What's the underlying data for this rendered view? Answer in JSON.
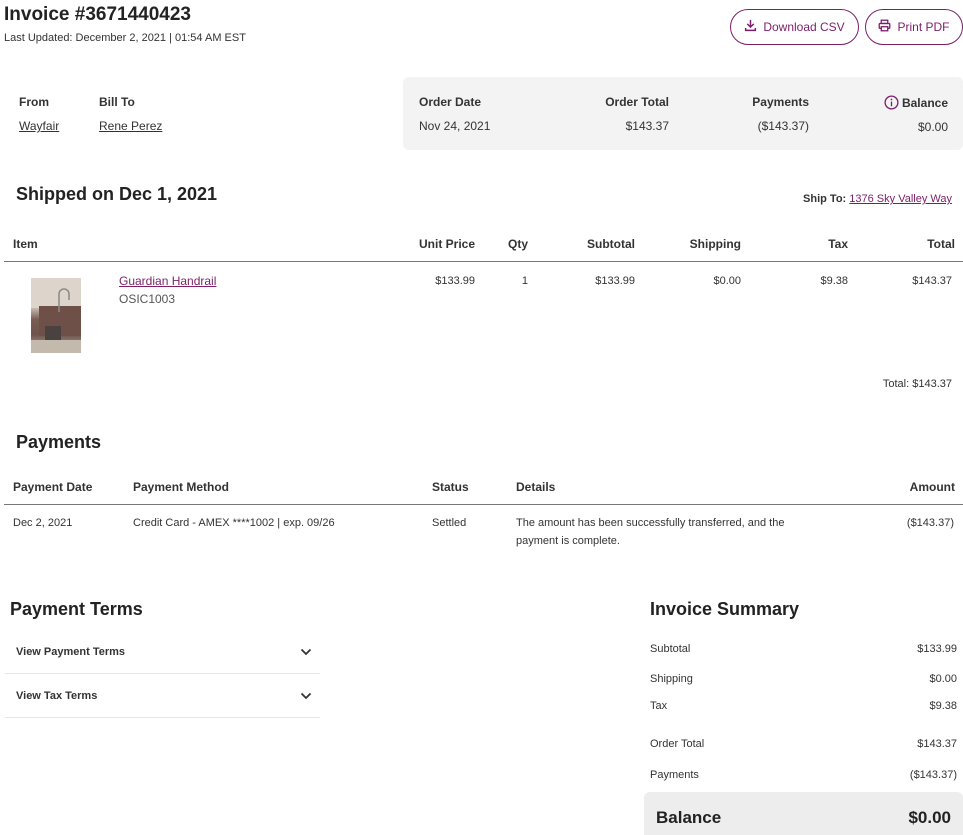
{
  "header": {
    "title": "Invoice #3671440423",
    "last_updated": "Last Updated: December 2, 2021 | 01:54 AM EST",
    "download_csv": "Download CSV",
    "print_pdf": "Print PDF",
    "download_icon": "download-icon",
    "print_icon": "printer-icon"
  },
  "parties": {
    "from_label": "From",
    "from_value": "Wayfair",
    "bill_to_label": "Bill To",
    "bill_to_value": "Rene Perez"
  },
  "order_summary": {
    "order_date_label": "Order Date",
    "order_date": "Nov 24, 2021",
    "order_total_label": "Order Total",
    "order_total": "$143.37",
    "payments_label": "Payments",
    "payments": "($143.37)",
    "balance_label": "Balance",
    "balance": "$0.00",
    "info_icon": "info-icon"
  },
  "shipment": {
    "title": "Shipped on Dec 1, 2021",
    "ship_to_label": "Ship To:",
    "ship_to_value": "1376 Sky Valley Way",
    "columns": [
      "Item",
      "Unit Price",
      "Qty",
      "Subtotal",
      "Shipping",
      "Tax",
      "Total"
    ],
    "items": [
      {
        "name": "Guardian Handrail",
        "sku": "OSIC1003",
        "unit_price": "$133.99",
        "qty": "1",
        "subtotal": "$133.99",
        "shipping": "$0.00",
        "tax": "$9.38",
        "total": "$143.37"
      }
    ],
    "total_text": "Total: $143.37"
  },
  "payments": {
    "title": "Payments",
    "columns": [
      "Payment Date",
      "Payment Method",
      "Status",
      "Details",
      "Amount"
    ],
    "rows": [
      {
        "date": "Dec 2, 2021",
        "method": "Credit Card - AMEX ****1002 | exp. 09/26",
        "status": "Settled",
        "details_line1": "The amount has been successfully transferred, and the",
        "details_line2": "payment is complete.",
        "amount": "($143.37)"
      }
    ]
  },
  "payment_terms": {
    "title": "Payment Terms",
    "items": [
      {
        "label": "View Payment Terms",
        "icon": "chevron-down-icon"
      },
      {
        "label": "View Tax Terms",
        "icon": "chevron-down-icon"
      }
    ]
  },
  "invoice_summary": {
    "title": "Invoice Summary",
    "subtotal_label": "Subtotal",
    "subtotal": "$133.99",
    "shipping_label": "Shipping",
    "shipping": "$0.00",
    "tax_label": "Tax",
    "tax": "$9.38",
    "order_total_label": "Order Total",
    "order_total": "$143.37",
    "payments_label": "Payments",
    "payments": "($143.37)",
    "balance_label": "Balance",
    "balance": "$0.00"
  },
  "colors": {
    "accent": "#7b1f6a",
    "panel_bg": "#f3f3f3"
  }
}
